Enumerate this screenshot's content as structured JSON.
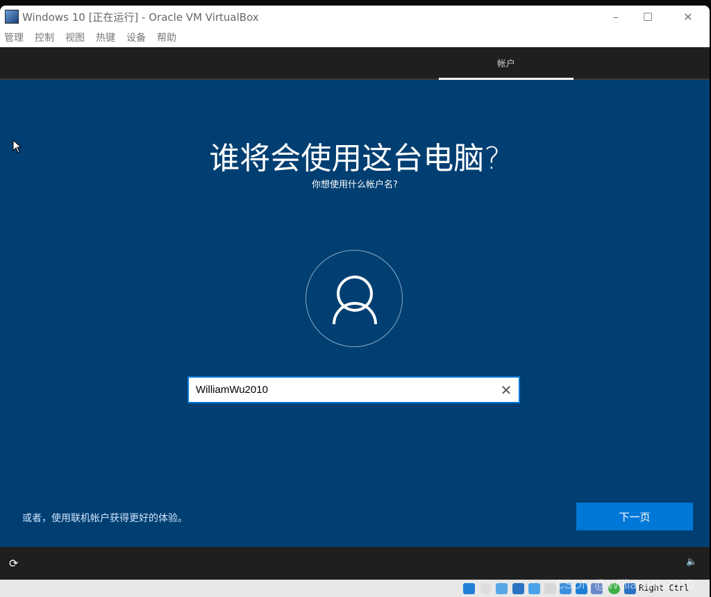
{
  "window": {
    "title": "Windows 10 [正在运行] - Oracle VM VirtualBox",
    "minimize": "–",
    "maximize": "☐",
    "close": "✕"
  },
  "menu": [
    "管理",
    "控制",
    "视图",
    "热键",
    "设备",
    "帮助"
  ],
  "oobe": {
    "tab": "帐户",
    "heading": "谁将会使用这台电脑?",
    "subheading": "你想使用什么帐户名?",
    "username_value": "WilliamWu2010",
    "clear_icon": "✕",
    "alt_link": "或者，使用联机帐户获得更好的体验。",
    "next_button": "下一页",
    "ease_icon": "⟳",
    "volume_icon": "🔈"
  },
  "status": {
    "host_key": "Right Ctrl",
    "watermark": "CSDN @WilliamWu2010"
  }
}
